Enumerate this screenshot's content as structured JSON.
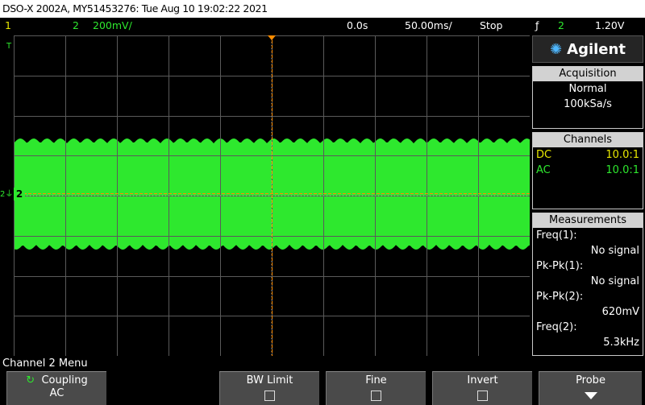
{
  "title": "DSO-X 2002A, MY51453276: Tue Aug 10 19:02:22 2021",
  "status": {
    "ch1": "1",
    "ch2": "2",
    "scale": "200mV/",
    "time_offset": "0.0s",
    "time_scale": "50.00ms/",
    "run_state": "Stop",
    "trigger_icon": "rising-edge",
    "trigger_source": "2",
    "trigger_level": "1.20V"
  },
  "brand": "Agilent",
  "acquisition": {
    "header": "Acquisition",
    "mode": "Normal",
    "rate": "100kSa/s"
  },
  "channels": {
    "header": "Channels",
    "rows": [
      {
        "coupling": "DC",
        "probe": "10.0:1",
        "color": "#e8e800"
      },
      {
        "coupling": "AC",
        "probe": "10.0:1",
        "color": "#2ee82e"
      }
    ]
  },
  "measurements": {
    "header": "Measurements",
    "items": [
      {
        "label": "Freq(1):",
        "value": "No signal"
      },
      {
        "label": "Pk-Pk(1):",
        "value": "No signal"
      },
      {
        "label": "Pk-Pk(2):",
        "value": "620mV"
      },
      {
        "label": "Freq(2):",
        "value": "5.3kHz"
      }
    ]
  },
  "menu_title": "Channel 2 Menu",
  "softkeys": {
    "coupling_label": "Coupling",
    "coupling_value": "AC",
    "bw_limit": "BW Limit",
    "fine": "Fine",
    "invert": "Invert",
    "probe": "Probe"
  },
  "trace": {
    "color": "#2ee82e",
    "amplitude_pk_pk": "620mV"
  }
}
